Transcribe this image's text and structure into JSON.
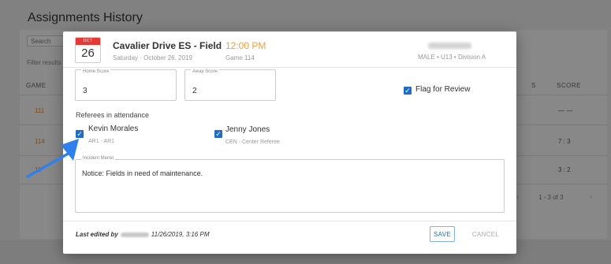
{
  "background": {
    "title": "Assignments History",
    "chip": "Search",
    "subtext": "Filter results",
    "col_game": "GAME",
    "col_s": "S",
    "col_score": "SCORE",
    "rows": [
      {
        "game": "111",
        "score": "— —"
      },
      {
        "game": "114",
        "score": "7 : 3"
      },
      {
        "game": "11",
        "score": "3 : 2"
      }
    ],
    "pagination": "1 - 3 of 3"
  },
  "modal": {
    "calendar": {
      "month": "OCT",
      "day": "26"
    },
    "venue": "Cavalier Drive ES - Field",
    "time": "12:00 PM",
    "date": "Saturday · October 26, 2019",
    "game": "Game 114",
    "division": "MALE • U13 • Division A",
    "home_score": {
      "label": "Home Score",
      "value": "3"
    },
    "away_score": {
      "label": "Away Score",
      "value": "2"
    },
    "flag_label": "Flag for Review",
    "referees_label": "Referees in attendance",
    "referees": [
      {
        "name": "Kevin Morales",
        "role": "AR1 - AR1"
      },
      {
        "name": "Jenny Jones",
        "role": "CEN - Center Referee"
      }
    ],
    "memo_label": "Incident Memo",
    "memo_text": "Notice: Fields in need of maintenance.",
    "last_edited_prefix": "Last edited by",
    "last_edited_date": "11/26/2019, 3:16 PM",
    "save_label": "SAVE",
    "cancel_label": "CANCEL"
  },
  "colors": {
    "accent": "#1e6ec8",
    "time": "#f0a040",
    "calendar_month": "#e53935",
    "game_id": "#e58a2e",
    "arrow": "#2f80ed"
  },
  "icons": {
    "checkbox": "check-icon",
    "calendar": "calendar-icon",
    "annotation": "arrow-icon"
  }
}
